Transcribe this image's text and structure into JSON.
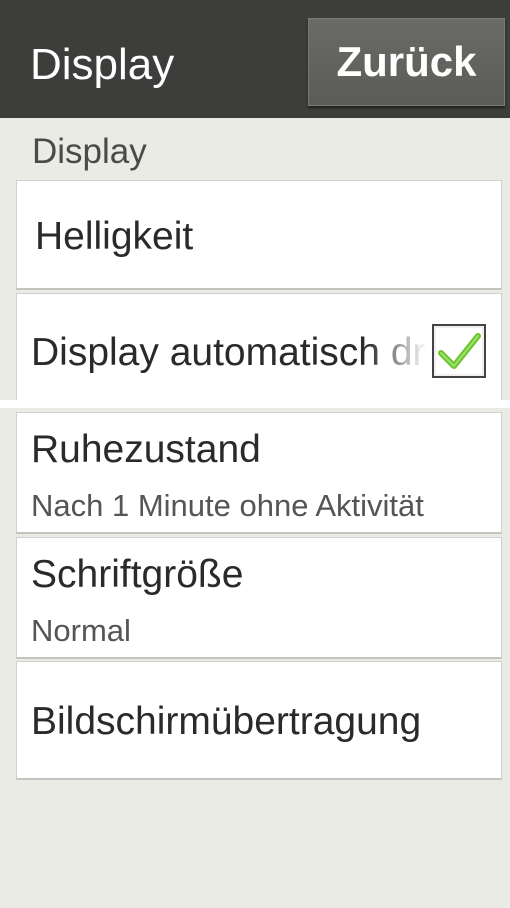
{
  "header": {
    "title": "Display",
    "back_label": "Zurück"
  },
  "section": {
    "label": "Display"
  },
  "items": [
    {
      "title": "Helligkeit"
    },
    {
      "title": "Display automatisch drehen",
      "checked": true
    },
    {
      "title": "Ruhezustand",
      "subtitle": "Nach 1 Minute ohne Aktivität"
    },
    {
      "title": "Schriftgröße",
      "subtitle": "Normal"
    },
    {
      "title": "Bildschirmübertragung"
    }
  ],
  "colors": {
    "header_bg": "#3d3d3b",
    "background": "#ebebe6",
    "check_green": "#6cc32e"
  }
}
